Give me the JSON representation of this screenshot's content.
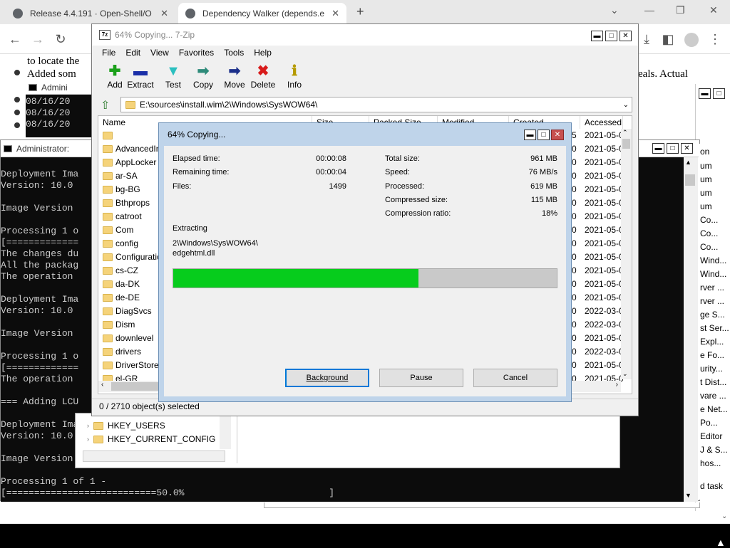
{
  "browser": {
    "tabs": [
      {
        "title": "Release 4.4.191 · Open-Shell/O",
        "close": "✕"
      },
      {
        "title": "Dependency Walker (depends.e",
        "close": "✕"
      }
    ],
    "new_tab": "+",
    "window_controls": {
      "dropdown": "⌄",
      "min": "—",
      "restore": "❐",
      "close": "✕"
    },
    "web_text": [
      "to locate the",
      "Added som",
      "eals. Actual"
    ]
  },
  "console_back": {
    "title": "Admini",
    "lines": [
      "08/16/20",
      "08/16/20",
      "08/16/20"
    ]
  },
  "console_main": {
    "title": "Administrator:",
    "lines": [
      "Deployment Ima",
      "Version: 10.0",
      "",
      "Image Version",
      "",
      "Processing 1 o",
      "[=============",
      "The changes du",
      "All the packag",
      "The operation",
      "",
      "Deployment Ima",
      "Version: 10.0",
      "",
      "Image Version",
      "",
      "Processing 1 o",
      "[=============",
      "The operation",
      "",
      "=== Adding LCU",
      "",
      "Deployment Ima",
      "Version: 10.0",
      "",
      "Image Version",
      "",
      "Processing 1 of 1 -",
      "[===========================50.0%                          ]"
    ]
  },
  "zip": {
    "title": "64% Copying... 7-Zip",
    "menu": [
      "File",
      "Edit",
      "View",
      "Favorites",
      "Tools",
      "Help"
    ],
    "toolbar": [
      {
        "label": "Add",
        "icon": "add-icon",
        "glyph": "✚",
        "color": "#1aa01a"
      },
      {
        "label": "Extract",
        "icon": "extract-icon",
        "glyph": "▬",
        "color": "#1b2fa8"
      },
      {
        "label": "Test",
        "icon": "test-icon",
        "glyph": "▼",
        "color": "#2bbfbf"
      },
      {
        "label": "Copy",
        "icon": "copy-icon",
        "glyph": "➡",
        "color": "#2e8b7a"
      },
      {
        "label": "Move",
        "icon": "move-icon",
        "glyph": "➡",
        "color": "#1b2f8a"
      },
      {
        "label": "Delete",
        "icon": "delete-icon",
        "glyph": "✖",
        "color": "#d81b1b"
      },
      {
        "label": "Info",
        "icon": "info-icon",
        "glyph": "ℹ",
        "color": "#b59a00"
      }
    ],
    "path": "E:\\sources\\install.wim\\2\\Windows\\SysWOW64\\",
    "columns": [
      "Name",
      "Size",
      "Packed Size",
      "Modified",
      "Created",
      "Accessed"
    ],
    "files": [
      {
        "name": "",
        "created": "5",
        "accessed": "2021-05-0"
      },
      {
        "name": "AdvancedIn",
        "created": "0",
        "accessed": "2021-05-0"
      },
      {
        "name": "AppLocker",
        "created": "0",
        "accessed": "2021-05-0"
      },
      {
        "name": "ar-SA",
        "created": "0",
        "accessed": "2021-05-0"
      },
      {
        "name": "bg-BG",
        "created": "0",
        "accessed": "2021-05-0"
      },
      {
        "name": "Bthprops",
        "created": "0",
        "accessed": "2021-05-0"
      },
      {
        "name": "catroot",
        "created": "0",
        "accessed": "2021-05-0"
      },
      {
        "name": "Com",
        "created": "0",
        "accessed": "2021-05-0"
      },
      {
        "name": "config",
        "created": "0",
        "accessed": "2021-05-0"
      },
      {
        "name": "Configuratio",
        "created": "0",
        "accessed": "2021-05-0"
      },
      {
        "name": "cs-CZ",
        "created": "0",
        "accessed": "2021-05-0"
      },
      {
        "name": "da-DK",
        "created": "0",
        "accessed": "2021-05-0"
      },
      {
        "name": "de-DE",
        "created": "0",
        "accessed": "2021-05-0"
      },
      {
        "name": "DiagSvcs",
        "created": "0",
        "accessed": "2022-03-0"
      },
      {
        "name": "Dism",
        "created": "0",
        "accessed": "2022-03-0"
      },
      {
        "name": "downlevel",
        "created": "0",
        "accessed": "2021-05-0"
      },
      {
        "name": "drivers",
        "created": "0",
        "accessed": "2022-03-0"
      },
      {
        "name": "DriverStore",
        "created": "0",
        "accessed": "2021-05-0"
      },
      {
        "name": "el-GR",
        "created": "0",
        "accessed": "2021-05-0"
      }
    ],
    "status": "0 / 2710 object(s) selected"
  },
  "dialog": {
    "title": "64% Copying...",
    "left_stats": [
      {
        "label": "Elapsed time:",
        "value": "00:00:08"
      },
      {
        "label": "Remaining time:",
        "value": "00:00:04"
      },
      {
        "label": "Files:",
        "value": "1499"
      }
    ],
    "right_stats": [
      {
        "label": "Total size:",
        "value": "961 MB"
      },
      {
        "label": "Speed:",
        "value": "76 MB/s"
      },
      {
        "label": "Processed:",
        "value": "619 MB"
      },
      {
        "label": "Compressed size:",
        "value": "115 MB"
      },
      {
        "label": "Compression ratio:",
        "value": "18%"
      }
    ],
    "operation": "Extracting",
    "current_dir": "2\\Windows\\SysWOW64\\",
    "current_file": "edgehtml.dll",
    "progress": 0.64,
    "progress_color": "#06cc1c",
    "buttons": {
      "background": "Background",
      "pause": "Pause",
      "cancel": "Cancel"
    }
  },
  "registry": {
    "items": [
      "HKEY_USERS",
      "HKEY_CURRENT_CONFIG"
    ]
  },
  "right_panel": {
    "header": "on",
    "items": [
      "um",
      "um",
      "um",
      "um",
      "Co...",
      "Co...",
      "Co...",
      "Wind...",
      "Wind...",
      "rver ...",
      "rver ...",
      "ge S...",
      "st Ser...",
      "Expl...",
      "e Fo...",
      "urity...",
      "t Dist...",
      "vare ...",
      "e Net...",
      "Po...",
      "Editor",
      "J & S...",
      "hos..."
    ],
    "footer": "d task"
  }
}
